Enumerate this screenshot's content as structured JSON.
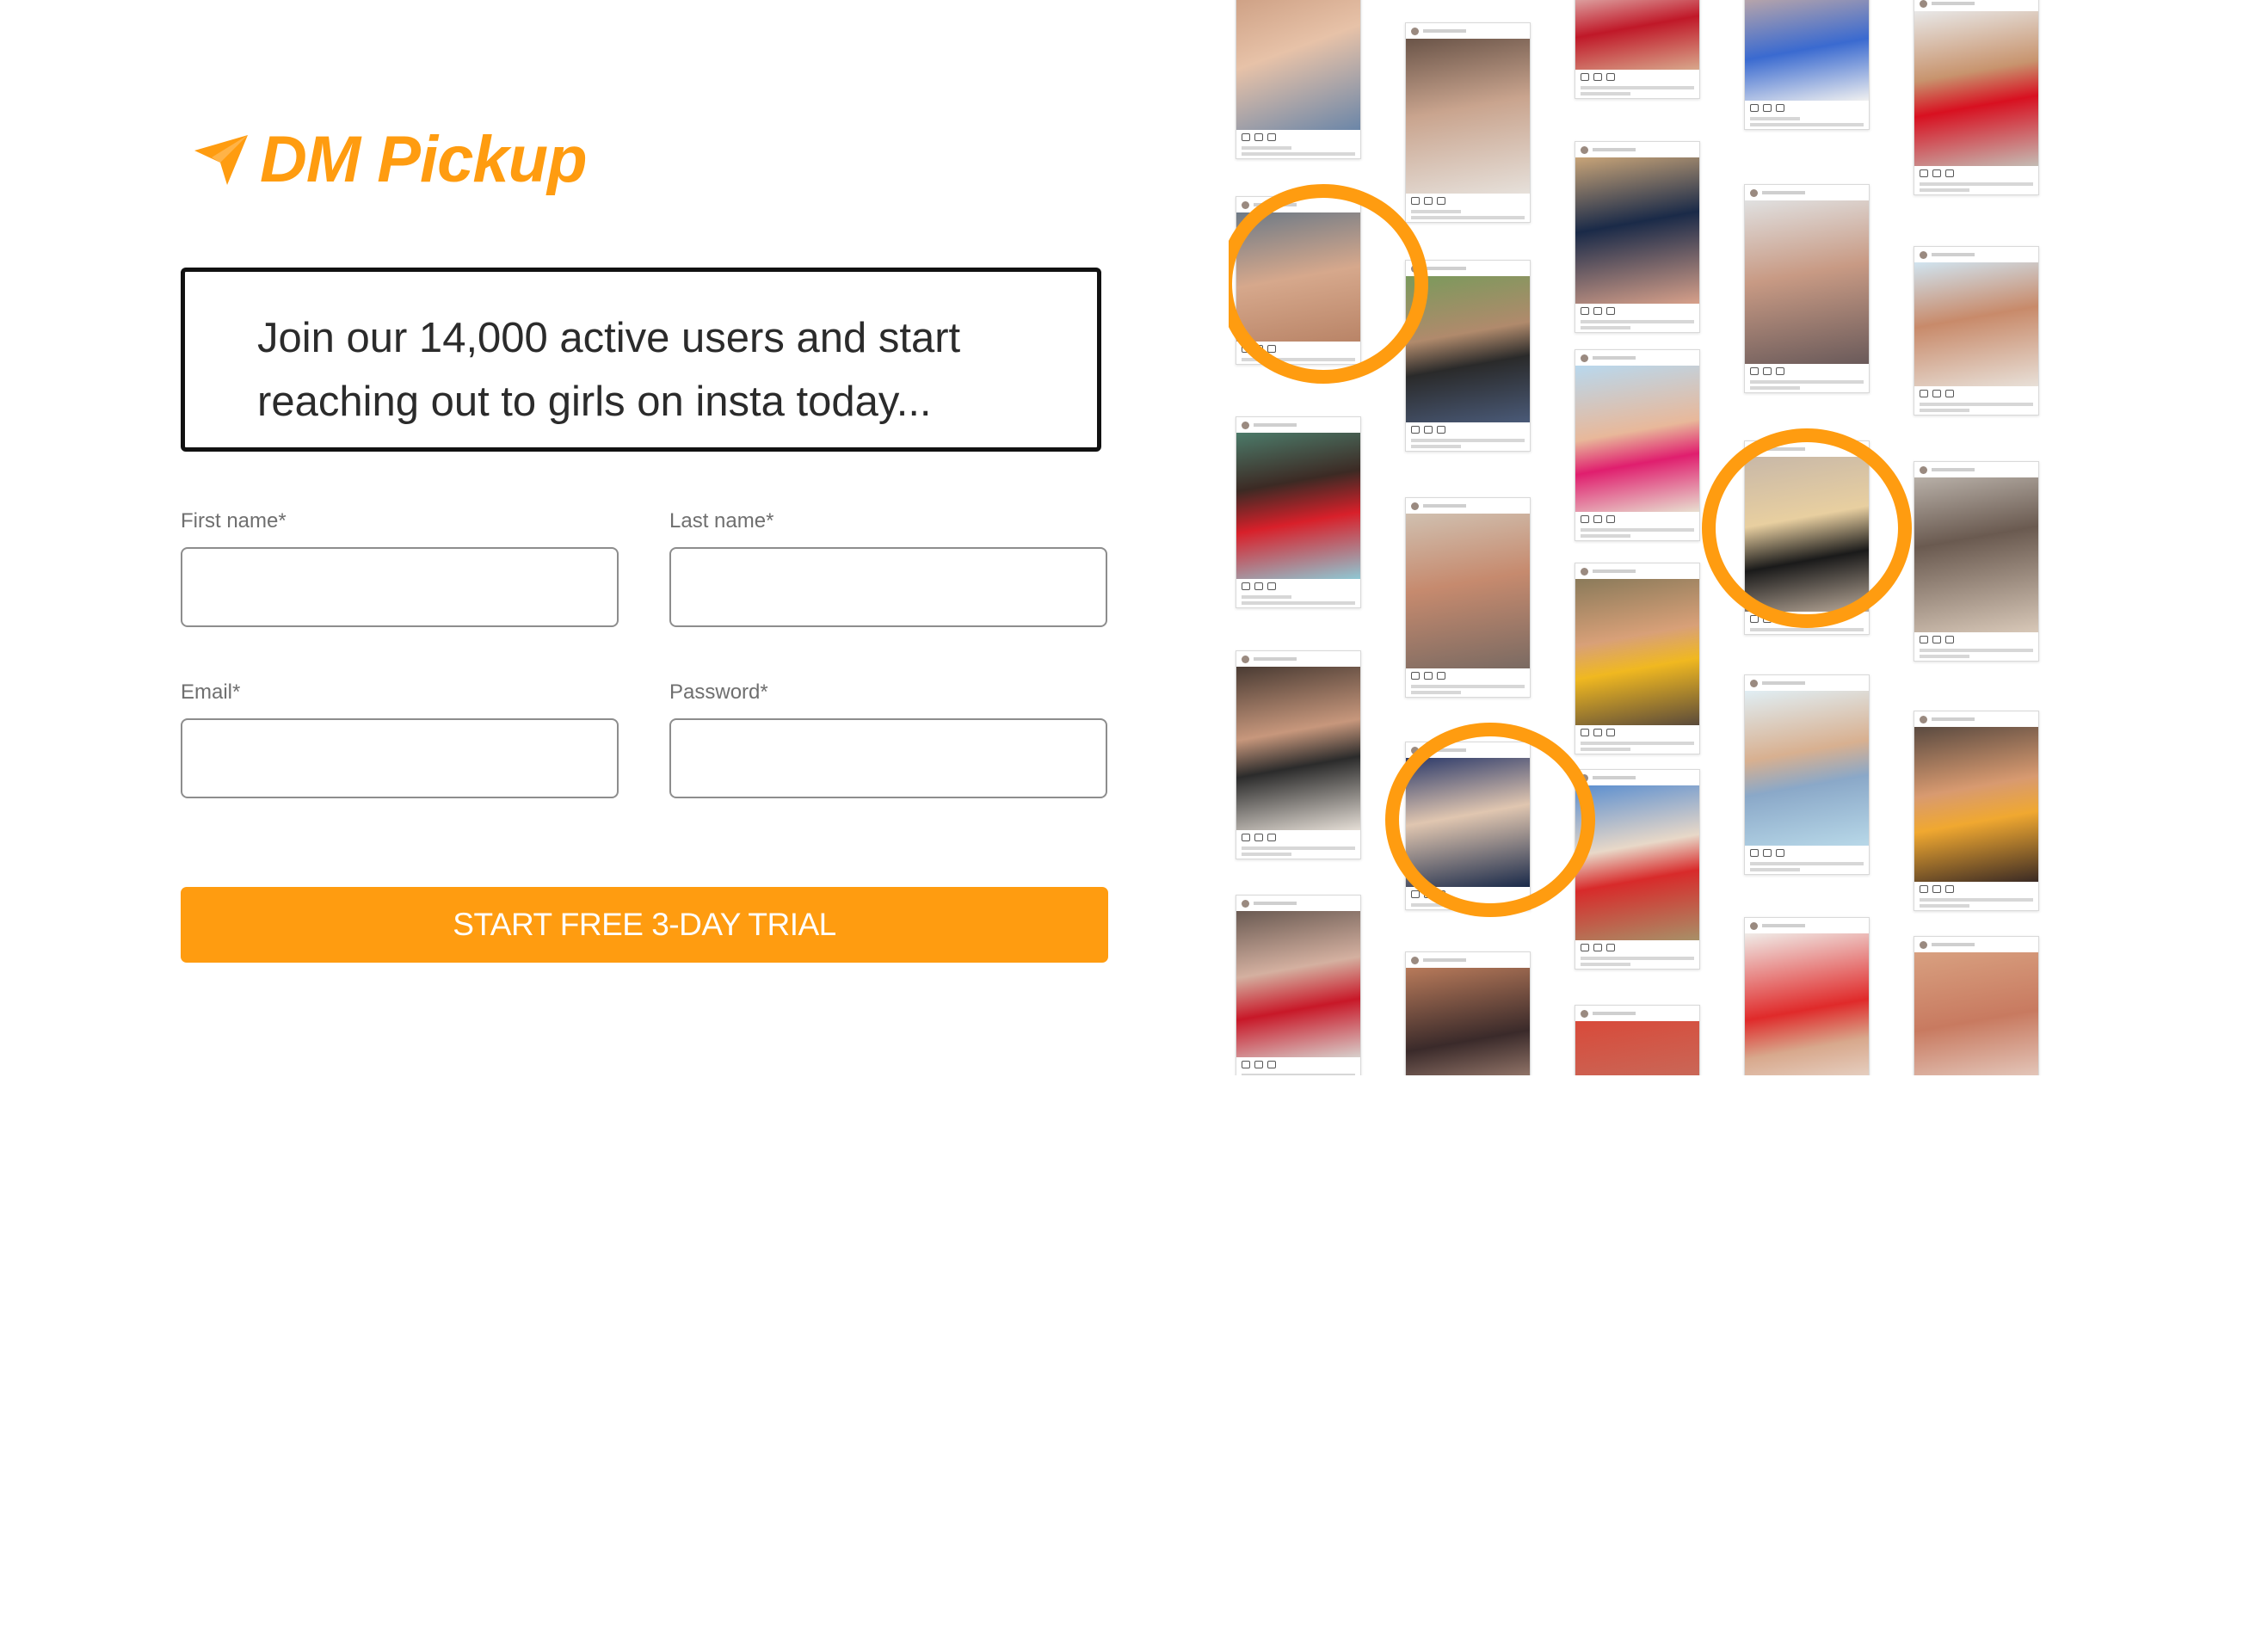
{
  "brand": {
    "name": "DM Pickup",
    "accent_color": "#ff9c10",
    "logo_icon": "paper-plane-icon"
  },
  "headline": {
    "line1": "Join our 14,000 active users and start",
    "line2": "reaching out to girls on insta today..."
  },
  "form": {
    "first_name_label": "First name*",
    "last_name_label": "Last name*",
    "email_label": "Email*",
    "password_label": "Password*",
    "first_name_value": "",
    "last_name_value": "",
    "email_value": "",
    "password_value": "",
    "submit_label": "START FREE 3-DAY TRIAL"
  },
  "collage": {
    "description_icon": "instagram-post-grid",
    "ring_color": "#ff9c10"
  }
}
